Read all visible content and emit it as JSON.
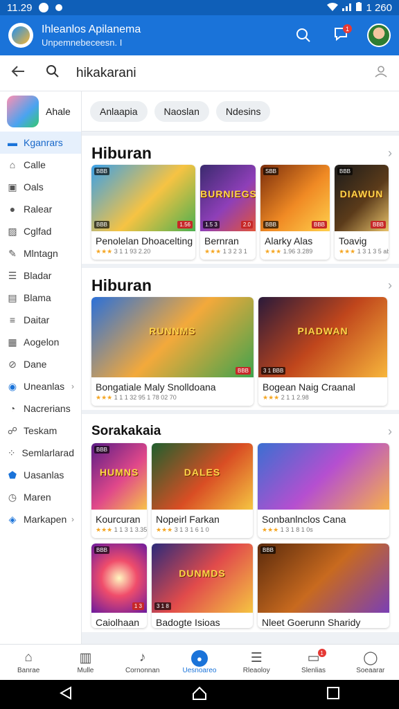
{
  "status_bar": {
    "time": "11.29",
    "right_text": "1 260"
  },
  "app_bar": {
    "title": "Ihleanlos Apilanema",
    "subtitle": "Unpemnebeceesn. I",
    "notification_count": "1"
  },
  "search": {
    "query": "hikakarani"
  },
  "sidebar": {
    "app_label": "Ahale",
    "items": [
      {
        "label": "Kganrars",
        "icon": "tag-icon",
        "active": true
      },
      {
        "label": "Calle",
        "icon": "home-icon"
      },
      {
        "label": "Oals",
        "icon": "box-icon"
      },
      {
        "label": "Ralear",
        "icon": "circle-icon"
      },
      {
        "label": "Cglfad",
        "icon": "image-icon"
      },
      {
        "label": "Mlntagn",
        "icon": "pen-icon"
      },
      {
        "label": "Bladar",
        "icon": "list-icon"
      },
      {
        "label": "Blama",
        "icon": "layers-icon"
      },
      {
        "label": "Daitar",
        "icon": "sliders-icon"
      },
      {
        "label": "Aogelon",
        "icon": "grid-icon"
      },
      {
        "label": "Dane",
        "icon": "circle-slash-icon"
      },
      {
        "label": "Uneanlas",
        "icon": "compass-icon",
        "chevron": true
      },
      {
        "label": "Nacrerians",
        "icon": "pie-icon"
      },
      {
        "label": "Teskam",
        "icon": "people-icon"
      },
      {
        "label": "Semlarlarad",
        "icon": "apps-icon"
      },
      {
        "label": "Uasanlas",
        "icon": "shield-icon"
      },
      {
        "label": "Maren",
        "icon": "clock-icon"
      },
      {
        "label": "Markapen",
        "icon": "bookmark-icon",
        "chevron": true
      }
    ]
  },
  "chips": [
    "Anlaapia",
    "Naoslan",
    "Ndesins"
  ],
  "sections": [
    {
      "title": "Hiburan",
      "cards": [
        {
          "name": "Penolelan Dhoacelting",
          "meta": "3 1 1 93 2.20",
          "art": "",
          "tl": "BBB",
          "bl": "BBB",
          "br": "1.56"
        },
        {
          "name": "Bernran",
          "meta": "1 3 2 3 1",
          "art": "BURNIEGS",
          "tl": "",
          "bl": "1.5 3",
          "br": "2.0"
        },
        {
          "name": "Alarky Alas",
          "meta": "1.96 3.289",
          "art": "",
          "tl": "SBB",
          "bl": "BBB",
          "br": "BBB"
        },
        {
          "name": "Toavig",
          "meta": "1 3 1 3 5 abo-",
          "art": "DIAWUN",
          "tl": "BBB",
          "bl": "",
          "br": "BBB"
        }
      ]
    },
    {
      "title": "Hiburan",
      "cards": [
        {
          "name": "Bongatiale Maly Snolldoana",
          "meta": "1 1 1 32 95 1 78 02 70",
          "art": "RUNNMS",
          "tl": "",
          "bl": "",
          "br": "BBB"
        },
        {
          "name": "Bogean Naig Craanal",
          "meta": "2 1 1 2.98",
          "art": "PIADWAN",
          "tl": "",
          "bl": "3 1 BBB",
          "br": ""
        }
      ]
    },
    {
      "title": "Sorakakaia",
      "cards": [
        {
          "name": "Kourcuran",
          "meta": "1 1 3 1 3.351",
          "art": "HUMNS",
          "tl": "BBB",
          "bl": "",
          "br": ""
        },
        {
          "name": "Nopeirl Farkan",
          "meta": "3 1 3 1 6 1 0",
          "art": "DALES",
          "tl": "",
          "bl": "",
          "br": ""
        },
        {
          "name": "Sonbanlnclos Cana",
          "meta": "1 3 1 8 1 0s",
          "art": "",
          "tl": "",
          "bl": "",
          "br": ""
        }
      ]
    },
    {
      "cards": [
        {
          "name": "Caiolhaan",
          "meta": "",
          "art": "",
          "tl": "BBB",
          "bl": "",
          "br": "1 3"
        },
        {
          "name": "Badogte Isioas",
          "meta": "",
          "art": "DUNMDS",
          "tl": "",
          "bl": "3 1 8",
          "br": ""
        },
        {
          "name": "Nleet Goerunn Sharidy",
          "meta": "",
          "art": "",
          "tl": "BBB",
          "bl": "",
          "br": ""
        }
      ]
    }
  ],
  "bottom_nav": [
    {
      "label": "Banrae",
      "icon": "home-icon"
    },
    {
      "label": "Mulle",
      "icon": "chart-icon"
    },
    {
      "label": "Cornonnan",
      "icon": "bell-icon"
    },
    {
      "label": "Uesnoareo",
      "icon": "drop-icon",
      "active": true
    },
    {
      "label": "Rleaoloy",
      "icon": "list-icon"
    },
    {
      "label": "Slenlias",
      "icon": "chat-icon",
      "badge": "1"
    },
    {
      "label": "Soeaarar",
      "icon": "person-icon"
    }
  ],
  "colors": {
    "primary": "#1a73d9",
    "status_bar": "#0f5fb8",
    "badge": "#e53935"
  }
}
